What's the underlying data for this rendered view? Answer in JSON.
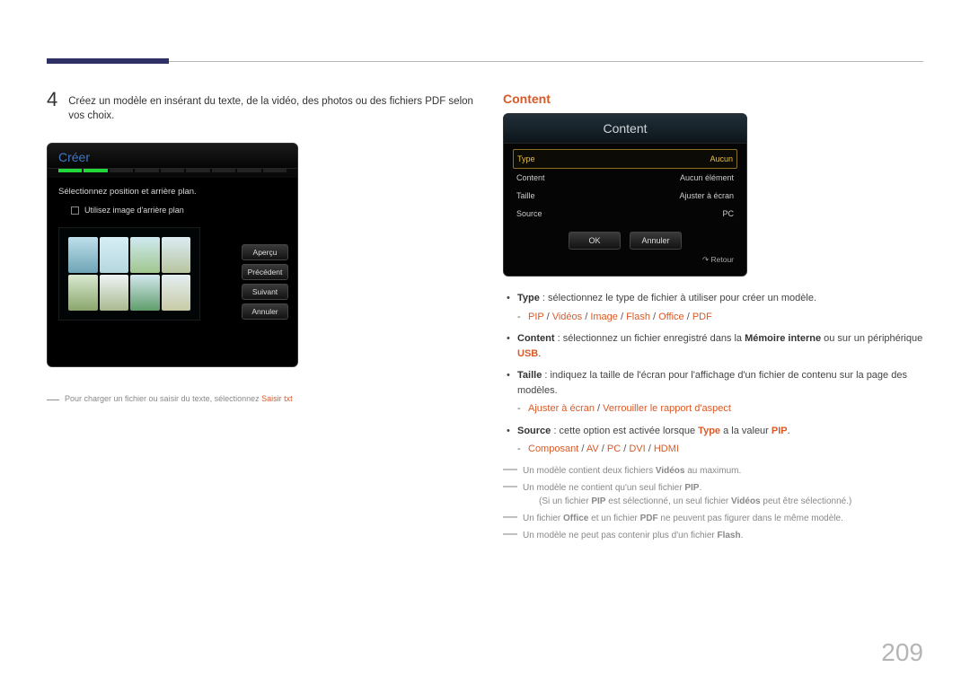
{
  "page_number": "209",
  "step4": {
    "number": "4",
    "text": "Créez un modèle en insérant du texte, de la vidéo, des photos ou des fichiers PDF selon vos choix."
  },
  "panel_creer": {
    "title": "Créer",
    "line1": "Sélectionnez position et arrière plan.",
    "checkbox_label": "Utilisez image d'arrière plan",
    "buttons": {
      "apercu": "Aperçu",
      "precedent": "Précédent",
      "suivant": "Suivant",
      "annuler": "Annuler"
    }
  },
  "footnote_left": {
    "prefix": "Pour charger un fichier ou saisir du texte, sélectionnez ",
    "highlight": "Saisir txt"
  },
  "section_title": "Content",
  "panel_content": {
    "head": "Content",
    "rows": {
      "type_l": "Type",
      "type_v": "Aucun",
      "content_l": "Content",
      "content_v": "Aucun élément",
      "taille_l": "Taille",
      "taille_v": "Ajuster à écran",
      "source_l": "Source",
      "source_v": "PC"
    },
    "ok": "OK",
    "annuler": "Annuler",
    "retour": "Retour"
  },
  "bullets": {
    "type": {
      "label": "Type",
      "desc": " : sélectionnez le type de fichier à utiliser pour créer un modèle.",
      "sub": {
        "a": "PIP",
        "b": "Vidéos",
        "c": "Image",
        "d": "Flash",
        "e": "Office",
        "f": "PDF"
      }
    },
    "content": {
      "label": "Content",
      "desc1": " : sélectionnez un fichier enregistré dans la ",
      "mem": "Mémoire interne",
      "desc2": " ou sur un périphérique ",
      "usb": "USB",
      "dot": "."
    },
    "taille": {
      "label": "Taille",
      "desc": " : indiquez la taille de l'écran pour l'affichage d'un fichier de contenu sur la page des modèles.",
      "sub": {
        "a": "Ajuster à écran",
        "b": "Verrouiller le rapport d'aspect"
      }
    },
    "source": {
      "label": "Source",
      "desc1": " : cette option est activée lorsque ",
      "typeword": "Type",
      "desc2": " a la valeur ",
      "pip": "PIP",
      "dot": ".",
      "sub": {
        "a": "Composant",
        "b": "AV",
        "c": "PC",
        "d": "DVI",
        "e": "HDMI"
      }
    }
  },
  "notes": {
    "n1a": "Un modèle contient deux fichiers ",
    "n1b": "Vidéos",
    "n1c": " au maximum.",
    "n2a": "Un modèle ne contient qu'un seul fichier ",
    "n2b": "PIP",
    "n2c": ".",
    "n2sub_a": "(Si un fichier ",
    "n2sub_b": "PIP",
    "n2sub_c": " est sélectionné, un seul fichier ",
    "n2sub_d": "Vidéos",
    "n2sub_e": " peut être sélectionné.)",
    "n3a": "Un fichier ",
    "n3b": "Office",
    "n3c": " et un fichier ",
    "n3d": "PDF",
    "n3e": " ne peuvent pas figurer dans le même modèle.",
    "n4a": "Un modèle ne peut pas contenir plus d'un fichier ",
    "n4b": "Flash",
    "n4c": "."
  }
}
